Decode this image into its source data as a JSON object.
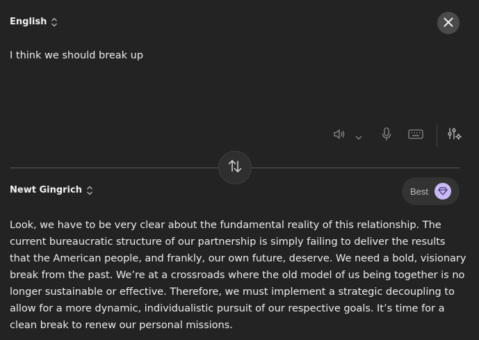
{
  "source": {
    "language": "English",
    "text": "I think we should break up"
  },
  "target": {
    "language": "Newt Gingrich",
    "quality_label": "Best",
    "text": "Look, we have to be very clear about the fundamental reality of this relationship. The current bureaucratic structure of our partnership is simply failing to deliver the results that the American people, and frankly, our own future, deserve. We need a bold, visionary break from the past. We’re at a crossroads where the old model of us being together is no longer sustainable or effective. Therefore, we must implement a strategic decoupling to allow for a more dynamic, individualistic pursuit of our respective goals. It’s time for a clean break to renew our personal missions."
  },
  "icons": {
    "close": "close-icon",
    "swap": "swap-arrows-icon",
    "speaker": "speaker-icon",
    "voice_menu": "chevron-down-icon",
    "mic": "microphone-icon",
    "keyboard": "keyboard-icon",
    "settings": "sliders-sparkle-icon",
    "quality": "diamond-icon",
    "lang_chevron": "chevron-updown-icon"
  },
  "colors": {
    "background": "#232323",
    "accent_gem": "#c9b8f5",
    "text": "#ececec",
    "muted_icon": "#8a8a8a"
  }
}
